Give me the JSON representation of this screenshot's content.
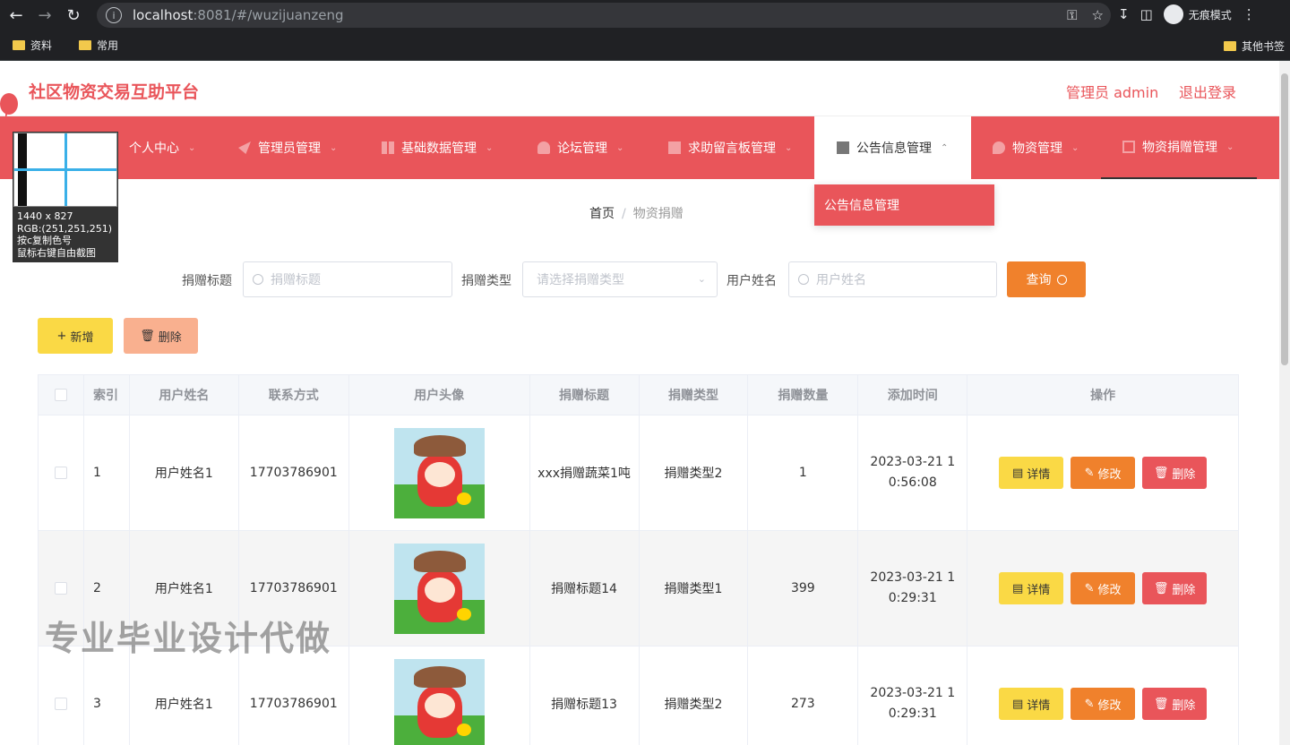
{
  "browser": {
    "url_host": "localhost",
    "url_rest": ":8081/#/wuzijuanzeng",
    "incognito_label": "无痕模式",
    "bookmarks": [
      "资料",
      "常用"
    ],
    "bookmarks_right": "其他书签"
  },
  "header": {
    "site_title": "社区物资交易互助平台",
    "user": "管理员 admin",
    "logout": "退出登录"
  },
  "nav": {
    "items": [
      {
        "label": "个人中心"
      },
      {
        "label": "管理员管理"
      },
      {
        "label": "基础数据管理"
      },
      {
        "label": "论坛管理"
      },
      {
        "label": "求助留言板管理"
      },
      {
        "label": "公告信息管理"
      },
      {
        "label": "物资管理"
      },
      {
        "label": "物资捐赠管理"
      }
    ],
    "dropdown_item": "公告信息管理"
  },
  "breadcrumb": {
    "home": "首页",
    "current": "物资捐赠"
  },
  "search": {
    "title_label": "捐赠标题",
    "title_placeholder": "捐赠标题",
    "type_label": "捐赠类型",
    "type_placeholder": "请选择捐赠类型",
    "user_label": "用户姓名",
    "user_placeholder": "用户姓名",
    "query_button": "查询"
  },
  "actions": {
    "add": "新增",
    "delete": "删除"
  },
  "table": {
    "headers": [
      "索引",
      "用户姓名",
      "联系方式",
      "用户头像",
      "捐赠标题",
      "捐赠类型",
      "捐赠数量",
      "添加时间",
      "操作"
    ],
    "rows": [
      {
        "index": "1",
        "name": "用户姓名1",
        "phone": "17703786901",
        "title": "xxx捐赠蔬菜1吨",
        "type": "捐赠类型2",
        "qty": "1",
        "date1": "2023-03-21 1",
        "date2": "0:56:08"
      },
      {
        "index": "2",
        "name": "用户姓名1",
        "phone": "17703786901",
        "title": "捐赠标题14",
        "type": "捐赠类型1",
        "qty": "399",
        "date1": "2023-03-21 1",
        "date2": "0:29:31"
      },
      {
        "index": "3",
        "name": "用户姓名1",
        "phone": "17703786901",
        "title": "捐赠标题13",
        "type": "捐赠类型2",
        "qty": "273",
        "date1": "2023-03-21 1",
        "date2": "0:29:31"
      }
    ],
    "op_view": "详情",
    "op_edit": "修改",
    "op_delete": "删除"
  },
  "picker": {
    "line1": "1440 x 827",
    "line2": "RGB:(251,251,251)",
    "line3": "按c复制色号",
    "line4": "鼠标右键自由截图"
  },
  "watermark": "专业毕业设计代做",
  "colors": {
    "primary": "#e9555a",
    "orange": "#f0812c",
    "yellow": "#fad945"
  }
}
